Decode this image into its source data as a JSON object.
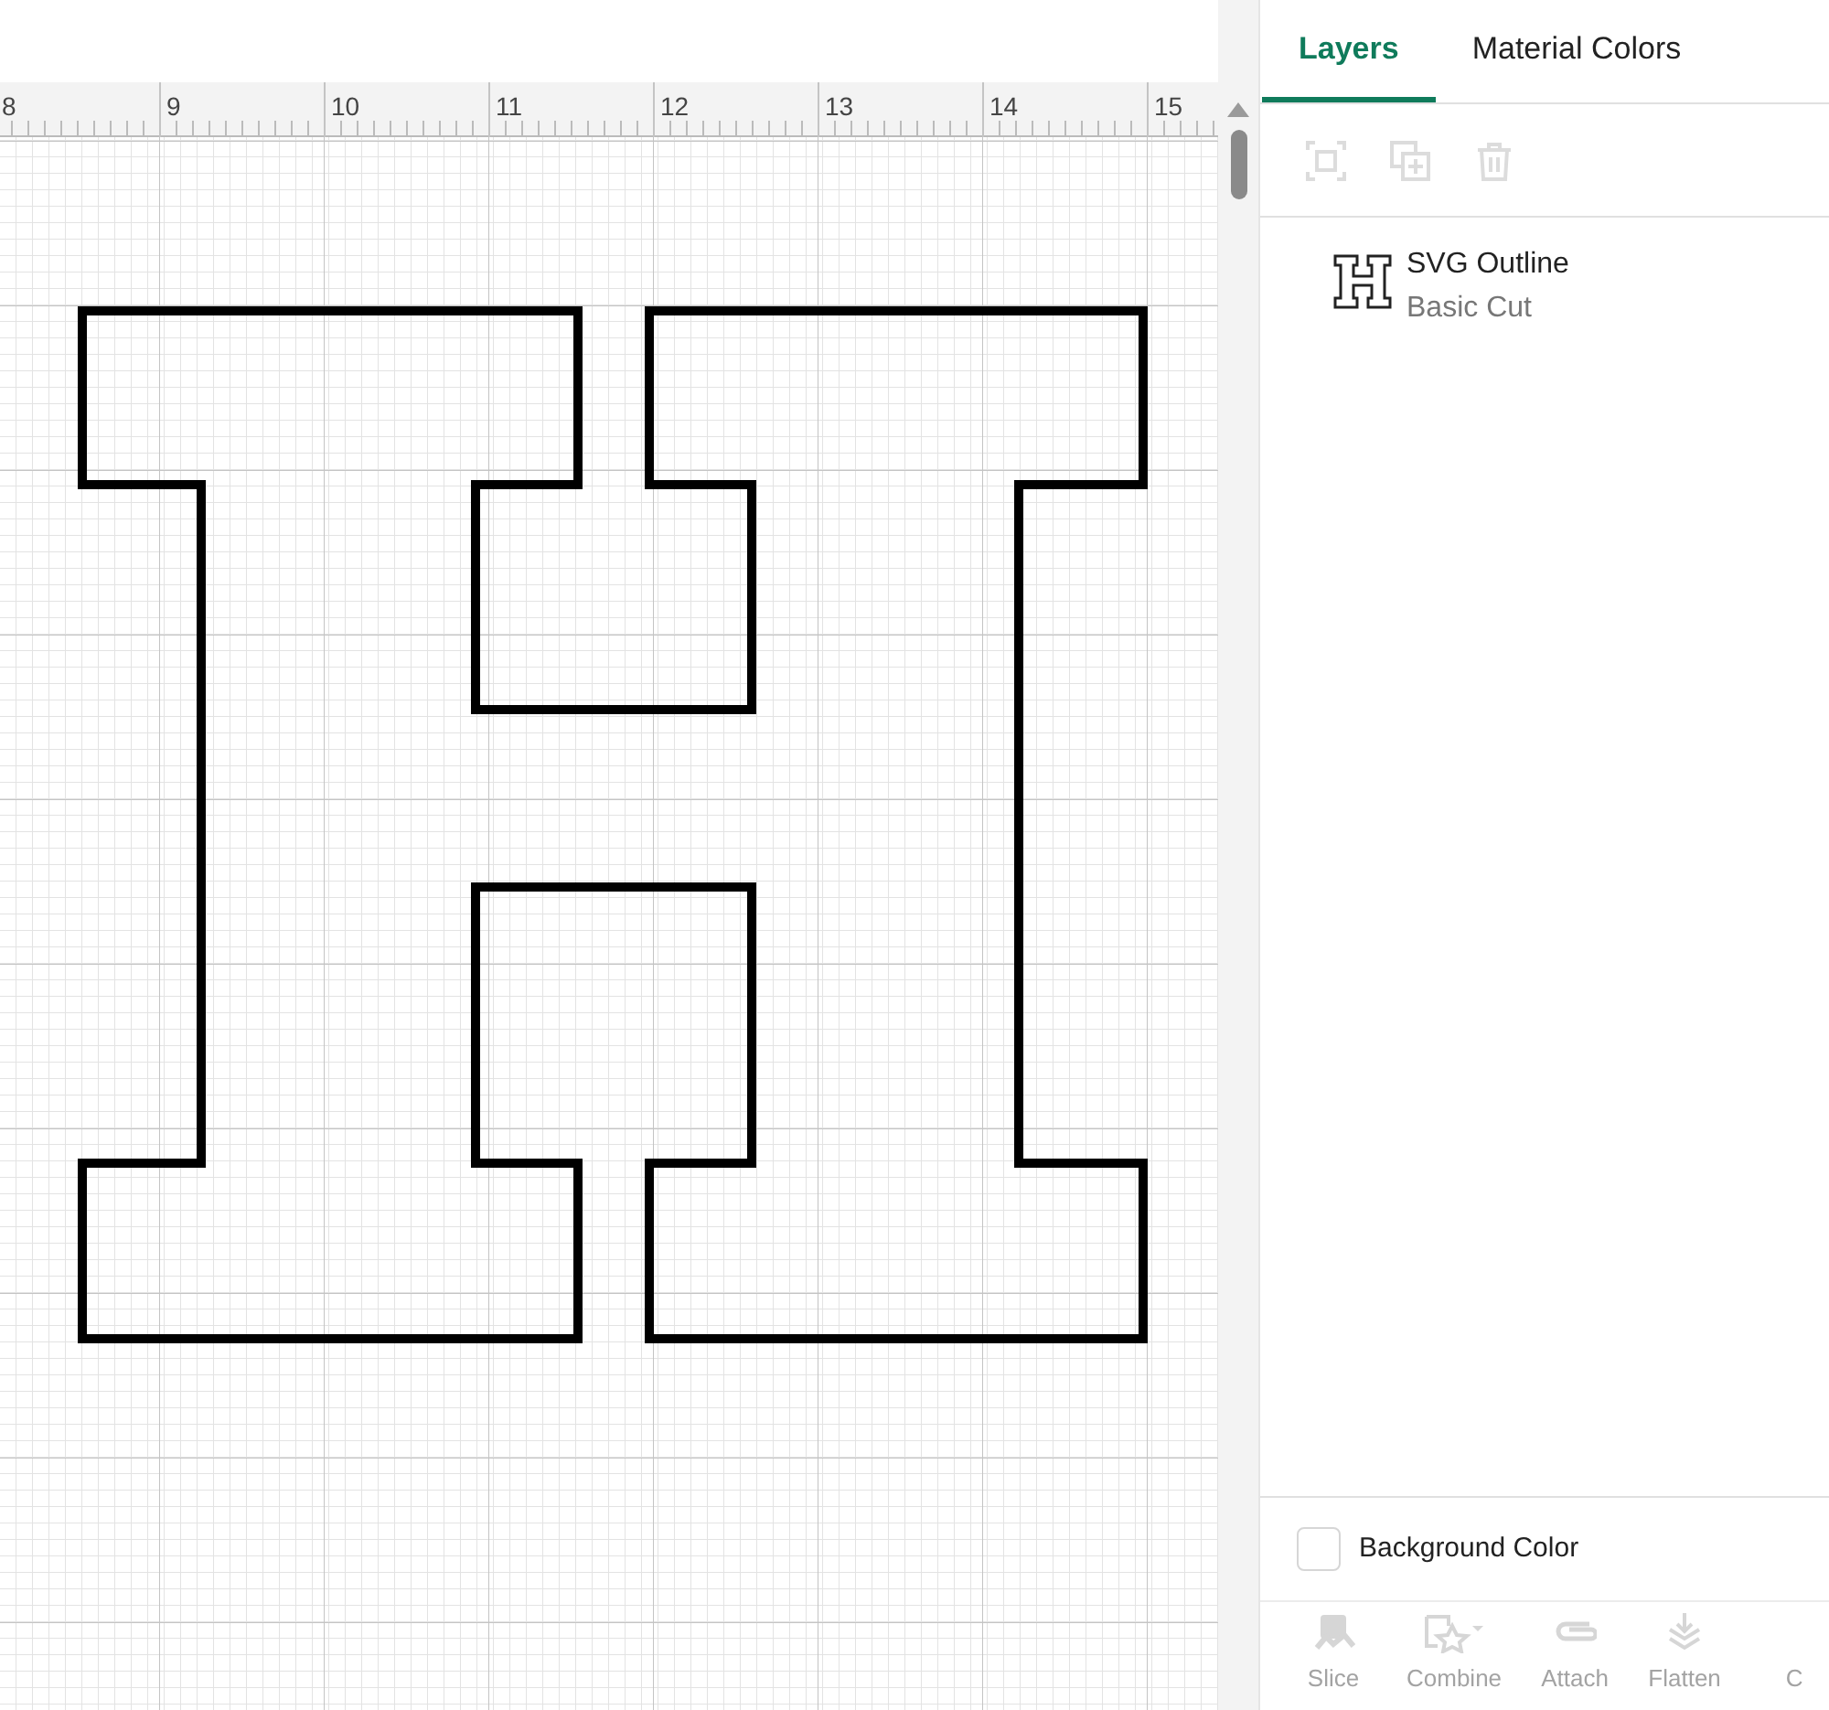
{
  "ruler": {
    "labels": [
      "8",
      "9",
      "10",
      "11",
      "12",
      "13",
      "14",
      "15"
    ]
  },
  "tabs": [
    {
      "label": "Layers",
      "selected": true
    },
    {
      "label": "Material Colors",
      "selected": false
    }
  ],
  "layer_tools": [
    {
      "kind": "group",
      "disabled": true
    },
    {
      "kind": "duplicate",
      "disabled": true
    },
    {
      "kind": "delete",
      "disabled": true
    }
  ],
  "layers": [
    {
      "name": "SVG Outline",
      "operation": "Basic Cut",
      "selected": false
    }
  ],
  "background_color": {
    "label": "Background Color",
    "checked": false
  },
  "bottom_toolbar": [
    {
      "kind": "slice",
      "label": "Slice",
      "disabled": true
    },
    {
      "kind": "combine",
      "label": "Combine",
      "disabled": true
    },
    {
      "kind": "attach",
      "label": "Attach",
      "disabled": true
    },
    {
      "kind": "flatten",
      "label": "Flatten",
      "disabled": true
    },
    {
      "kind": "contour",
      "label": "C",
      "disabled": true
    }
  ]
}
